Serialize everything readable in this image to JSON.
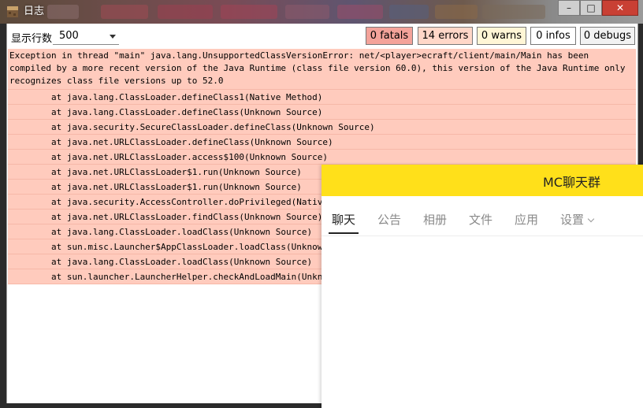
{
  "window": {
    "title": "日志"
  },
  "toolbar": {
    "rows_label": "显示行数",
    "rows_value": "500",
    "filters": [
      {
        "label": "0 fatals",
        "color": "#f4a39a"
      },
      {
        "label": "14 errors",
        "color": "#ffd7c8"
      },
      {
        "label": "0 warns",
        "color": "#fff6d6"
      },
      {
        "label": "0 infos",
        "color": "#ffffff"
      },
      {
        "label": "0 debugs",
        "color": "#f2f2f2"
      }
    ]
  },
  "log": {
    "entry_color": "#ffcbbd",
    "header": "Exception in thread \"main\" java.lang.UnsupportedClassVersionError: net/<player>ecraft/client/main/Main has been compiled by a more recent version of the Java Runtime (class file version 60.0), this version of the Java Runtime only recognizes class file versions up to 52.0",
    "frames": [
      "\tat java.lang.ClassLoader.defineClass1(Native Method)",
      "\tat java.lang.ClassLoader.defineClass(Unknown Source)",
      "\tat java.security.SecureClassLoader.defineClass(Unknown Source)",
      "\tat java.net.URLClassLoader.defineClass(Unknown Source)",
      "\tat java.net.URLClassLoader.access$100(Unknown Source)",
      "\tat java.net.URLClassLoader$1.run(Unknown Source)",
      "\tat java.net.URLClassLoader$1.run(Unknown Source)",
      "\tat java.security.AccessController.doPrivileged(Native",
      "\tat java.net.URLClassLoader.findClass(Unknown Source)",
      "\tat java.lang.ClassLoader.loadClass(Unknown Source)",
      "\tat sun.misc.Launcher$AppClassLoader.loadClass(Unknown",
      "\tat java.lang.ClassLoader.loadClass(Unknown Source)",
      "\tat sun.launcher.LauncherHelper.checkAndLoadMain(Unkno"
    ]
  },
  "chat": {
    "accent": "#ffe01a",
    "title": "MC聊天群",
    "tabs": [
      "聊天",
      "公告",
      "相册",
      "文件",
      "应用",
      "设置"
    ]
  }
}
